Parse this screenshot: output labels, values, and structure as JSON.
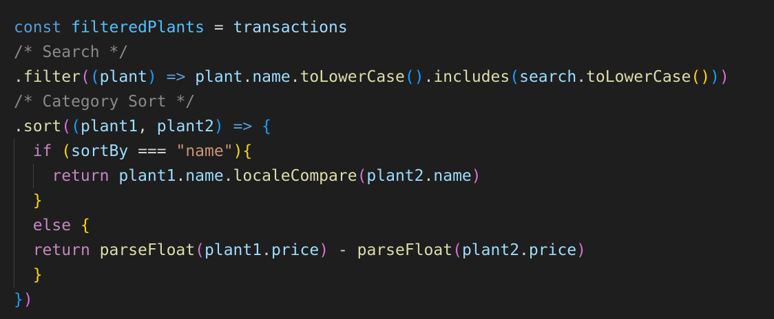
{
  "colors": {
    "background": "#1e1e1e",
    "keyword": "#569cd6",
    "control": "#c586c0",
    "variable": "#9cdcfe",
    "function": "#dcdcaa",
    "comment": "#6a9955",
    "string": "#ce9178",
    "bracket1": "#ffd700",
    "bracket2": "#da70d6",
    "bracket3": "#179fff",
    "plain": "#d4d4d4"
  },
  "code": {
    "lines": [
      {
        "indent": 0,
        "tokens": [
          {
            "t": "const",
            "c": "#569cd6"
          },
          {
            "t": " ",
            "c": "#d4d4d4"
          },
          {
            "t": "filteredPlants",
            "c": "#4fc1ff"
          },
          {
            "t": " = ",
            "c": "#d4d4d4"
          },
          {
            "t": "transactions",
            "c": "#9cdcfe"
          }
        ]
      },
      {
        "indent": 0,
        "tokens": [
          {
            "t": "/* Search */",
            "c": "#8a8a8a"
          }
        ]
      },
      {
        "indent": 0,
        "tokens": [
          {
            "t": ".",
            "c": "#d4d4d4"
          },
          {
            "t": "filter",
            "c": "#dcdcaa"
          },
          {
            "t": "(",
            "c": "#da70d6"
          },
          {
            "t": "(",
            "c": "#179fff"
          },
          {
            "t": "plant",
            "c": "#9cdcfe"
          },
          {
            "t": ")",
            "c": "#179fff"
          },
          {
            "t": " ",
            "c": "#d4d4d4"
          },
          {
            "t": "=>",
            "c": "#569cd6"
          },
          {
            "t": " ",
            "c": "#d4d4d4"
          },
          {
            "t": "plant",
            "c": "#9cdcfe"
          },
          {
            "t": ".",
            "c": "#d4d4d4"
          },
          {
            "t": "name",
            "c": "#9cdcfe"
          },
          {
            "t": ".",
            "c": "#d4d4d4"
          },
          {
            "t": "toLowerCase",
            "c": "#dcdcaa"
          },
          {
            "t": "()",
            "c": "#179fff"
          },
          {
            "t": ".",
            "c": "#d4d4d4"
          },
          {
            "t": "includes",
            "c": "#dcdcaa"
          },
          {
            "t": "(",
            "c": "#179fff"
          },
          {
            "t": "search",
            "c": "#9cdcfe"
          },
          {
            "t": ".",
            "c": "#d4d4d4"
          },
          {
            "t": "toLowerCase",
            "c": "#dcdcaa"
          },
          {
            "t": "()",
            "c": "#ffd700"
          },
          {
            "t": ")",
            "c": "#179fff"
          },
          {
            "t": ")",
            "c": "#da70d6"
          }
        ]
      },
      {
        "indent": 0,
        "tokens": [
          {
            "t": "/* Category Sort */",
            "c": "#8a8a8a"
          }
        ]
      },
      {
        "indent": 0,
        "tokens": [
          {
            "t": ".",
            "c": "#d4d4d4"
          },
          {
            "t": "sort",
            "c": "#dcdcaa"
          },
          {
            "t": "(",
            "c": "#da70d6"
          },
          {
            "t": "(",
            "c": "#179fff"
          },
          {
            "t": "plant1",
            "c": "#9cdcfe"
          },
          {
            "t": ", ",
            "c": "#d4d4d4"
          },
          {
            "t": "plant2",
            "c": "#9cdcfe"
          },
          {
            "t": ")",
            "c": "#179fff"
          },
          {
            "t": " ",
            "c": "#d4d4d4"
          },
          {
            "t": "=>",
            "c": "#569cd6"
          },
          {
            "t": " ",
            "c": "#d4d4d4"
          },
          {
            "t": "{",
            "c": "#179fff"
          }
        ]
      },
      {
        "indent": 1,
        "tokens": [
          {
            "t": "  ",
            "c": "#d4d4d4"
          },
          {
            "t": "if",
            "c": "#c586c0"
          },
          {
            "t": " ",
            "c": "#d4d4d4"
          },
          {
            "t": "(",
            "c": "#ffd700"
          },
          {
            "t": "sortBy",
            "c": "#9cdcfe"
          },
          {
            "t": " === ",
            "c": "#d4d4d4"
          },
          {
            "t": "\"name\"",
            "c": "#ce9178"
          },
          {
            "t": ")",
            "c": "#ffd700"
          },
          {
            "t": "{",
            "c": "#ffd700"
          }
        ]
      },
      {
        "indent": 2,
        "tokens": [
          {
            "t": "    ",
            "c": "#d4d4d4"
          },
          {
            "t": "return",
            "c": "#c586c0"
          },
          {
            "t": " ",
            "c": "#d4d4d4"
          },
          {
            "t": "plant1",
            "c": "#9cdcfe"
          },
          {
            "t": ".",
            "c": "#d4d4d4"
          },
          {
            "t": "name",
            "c": "#9cdcfe"
          },
          {
            "t": ".",
            "c": "#d4d4d4"
          },
          {
            "t": "localeCompare",
            "c": "#dcdcaa"
          },
          {
            "t": "(",
            "c": "#da70d6"
          },
          {
            "t": "plant2",
            "c": "#9cdcfe"
          },
          {
            "t": ".",
            "c": "#d4d4d4"
          },
          {
            "t": "name",
            "c": "#9cdcfe"
          },
          {
            "t": ")",
            "c": "#da70d6"
          }
        ]
      },
      {
        "indent": 1,
        "tokens": [
          {
            "t": "  ",
            "c": "#d4d4d4"
          },
          {
            "t": "}",
            "c": "#ffd700"
          }
        ]
      },
      {
        "indent": 1,
        "tokens": [
          {
            "t": "  ",
            "c": "#d4d4d4"
          },
          {
            "t": "else",
            "c": "#c586c0"
          },
          {
            "t": " ",
            "c": "#d4d4d4"
          },
          {
            "t": "{",
            "c": "#ffd700"
          }
        ]
      },
      {
        "indent": 1,
        "tokens": [
          {
            "t": "  ",
            "c": "#d4d4d4"
          },
          {
            "t": "return",
            "c": "#c586c0"
          },
          {
            "t": " ",
            "c": "#d4d4d4"
          },
          {
            "t": "parseFloat",
            "c": "#dcdcaa"
          },
          {
            "t": "(",
            "c": "#da70d6"
          },
          {
            "t": "plant1",
            "c": "#9cdcfe"
          },
          {
            "t": ".",
            "c": "#d4d4d4"
          },
          {
            "t": "price",
            "c": "#9cdcfe"
          },
          {
            "t": ")",
            "c": "#da70d6"
          },
          {
            "t": " - ",
            "c": "#d4d4d4"
          },
          {
            "t": "parseFloat",
            "c": "#dcdcaa"
          },
          {
            "t": "(",
            "c": "#da70d6"
          },
          {
            "t": "plant2",
            "c": "#9cdcfe"
          },
          {
            "t": ".",
            "c": "#d4d4d4"
          },
          {
            "t": "price",
            "c": "#9cdcfe"
          },
          {
            "t": ")",
            "c": "#da70d6"
          }
        ]
      },
      {
        "indent": 1,
        "tokens": [
          {
            "t": "  ",
            "c": "#d4d4d4"
          },
          {
            "t": "}",
            "c": "#ffd700"
          }
        ]
      },
      {
        "indent": 0,
        "tokens": [
          {
            "t": "}",
            "c": "#179fff"
          },
          {
            "t": ")",
            "c": "#da70d6"
          }
        ]
      }
    ]
  }
}
